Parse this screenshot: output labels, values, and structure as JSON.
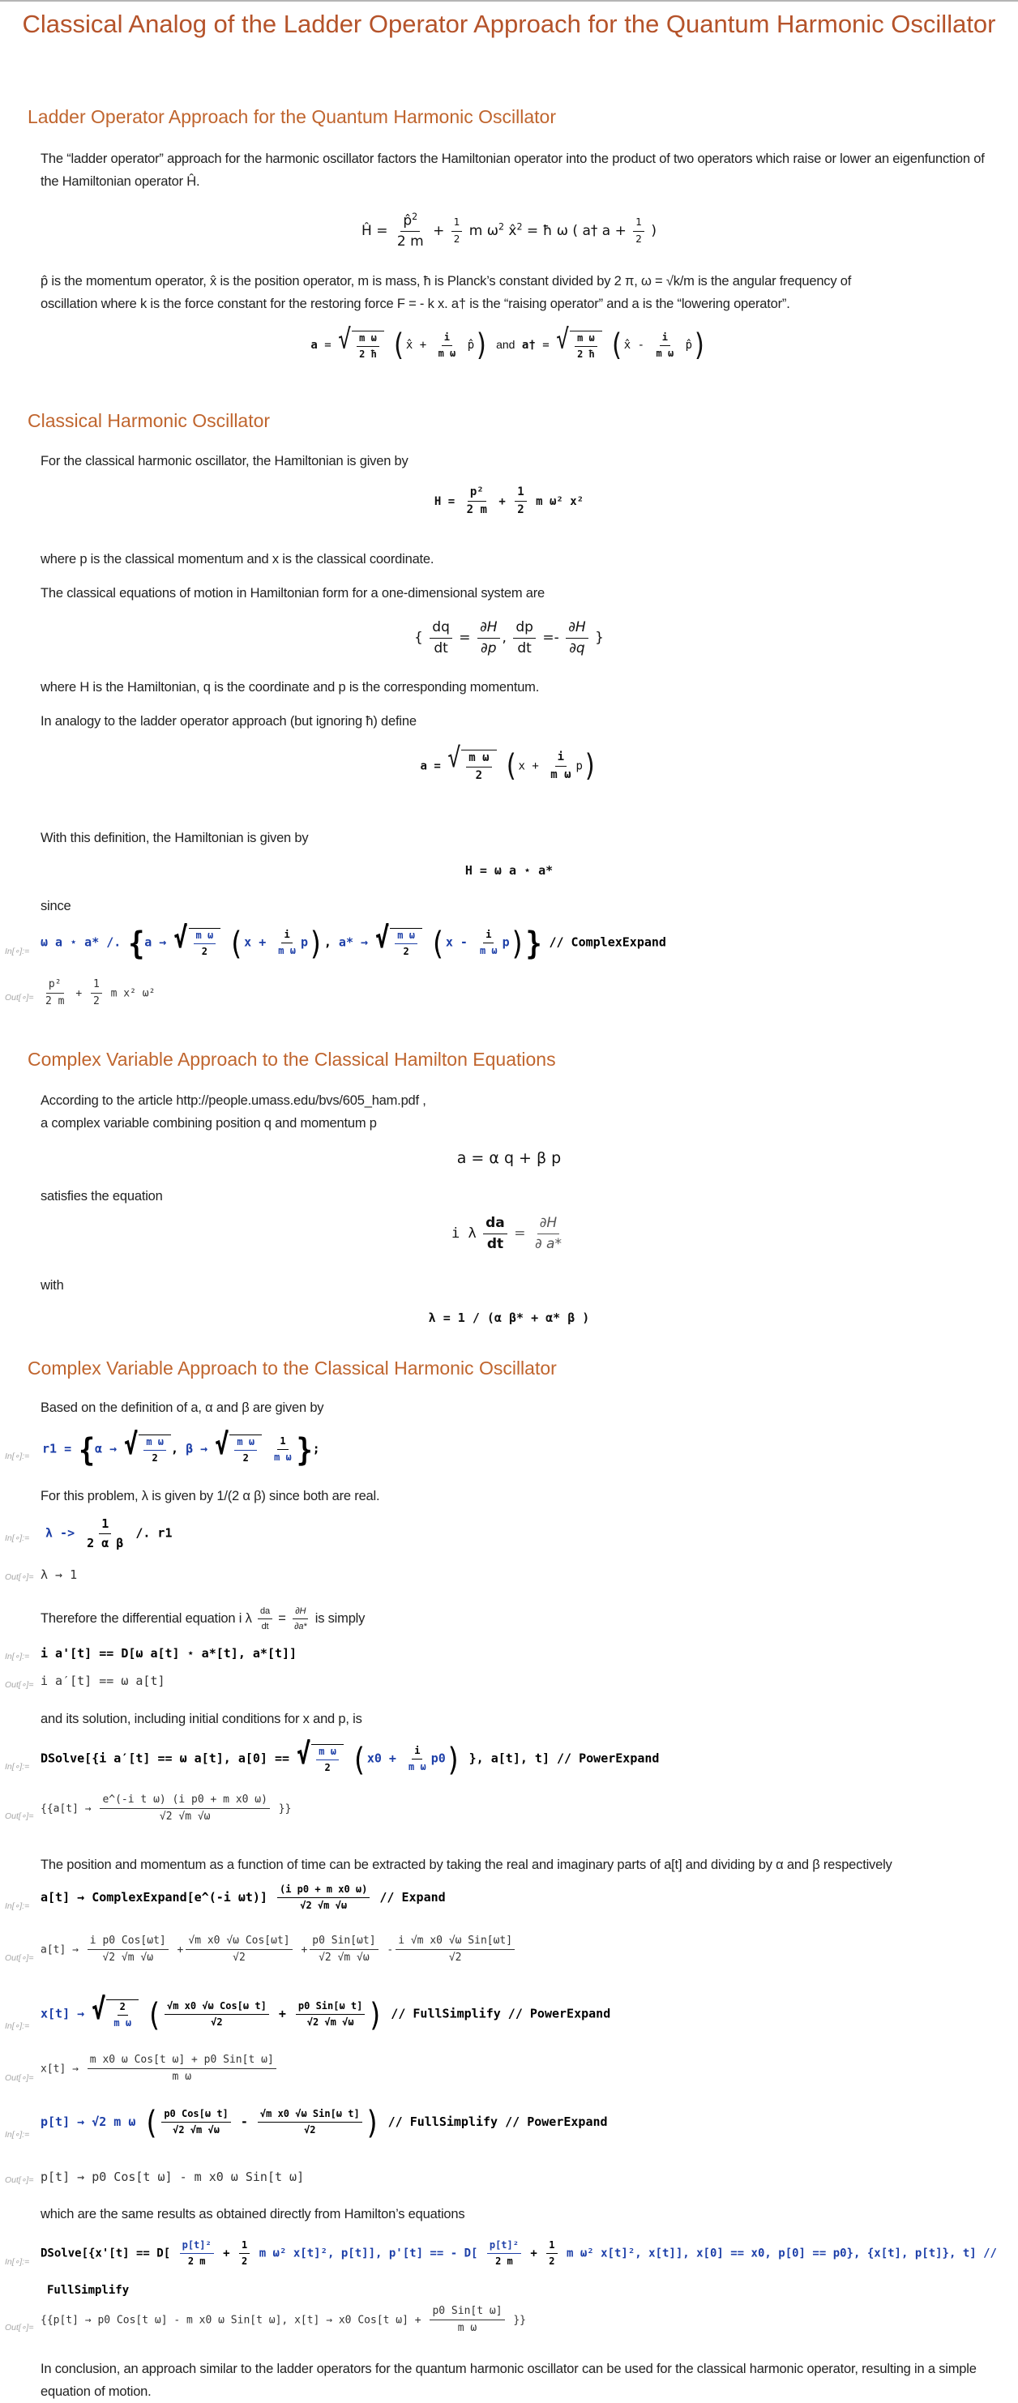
{
  "title": "Classical Analog of the Ladder Operator Approach for the Quantum Harmonic Oscillator",
  "sections": [
    {
      "heading": "Ladder Operator Approach for the Quantum Harmonic Oscillator",
      "p1": "The “ladder operator” approach for the harmonic oscillator factors the Hamiltonian operator into the product of two operators which raise or lower an eigenfunction of the Hamiltonian operator Ĥ.",
      "eq1": {
        "lhs": "Ĥ",
        "p_hat": "p̂",
        "p_exp": "2",
        "den1": "2 m",
        "half_num": "1",
        "half_den": "2",
        "mid": "m ω",
        "w_exp": "2",
        "x_hat": "x̂",
        "x_exp": "2",
        "rhs": "ħ ω ( a† a +",
        "rhs_half_num": "1",
        "rhs_half_den": "2",
        "close": ")"
      },
      "p2_line1": "p̂ is the momentum operator,  x̂ is the position operator, m is mass,  ħ is Planck’s constant divided by 2 π,  ω = √k/m  is the angular frequency of",
      "p2_line2": "oscillation where  k is the force constant for the restoring force F = - k x.    a† is the “raising operator” and a is the “lowering operator”.",
      "eq2": {
        "a": "a",
        "num": "m ω",
        "den": "2 ħ",
        "x": "x̂",
        "plus": "+",
        "i": "i",
        "mw": "m ω",
        "p": "p̂",
        "and": "and",
        "adag": "a†",
        "minus": "-"
      }
    },
    {
      "heading": "Classical Harmonic Oscillator",
      "p1": "For the classical harmonic oscillator,  the Hamiltonian is given by",
      "eq1": {
        "lhs": "H =",
        "num1": "p²",
        "den1": "2 m",
        "plus": "+",
        "num2": "1",
        "den2": "2",
        "tail": "m ω² x²"
      },
      "p2": "where p is the classical momentum and x is the classical coordinate.",
      "p3": "The classical equations of motion in Hamiltonian form for a one-dimensional system are",
      "eq2": {
        "open": "{",
        "dq": "dq",
        "dt": "dt",
        "dH": "∂H",
        "dp_": "∂p",
        "comma": ",",
        "dp": "dp",
        "dq_": "∂q",
        "neg": "-",
        "close": "}"
      },
      "p4": "where H is the Hamiltonian, q is the coordinate and p is the corresponding momentum.",
      "p5": "In analogy to the ladder operator approach (but ignoring ħ) define",
      "eq3": {
        "a": "a =",
        "num": "m ω",
        "den": "2",
        "x": "x +",
        "i": "i",
        "mw": "m ω",
        "p": "p"
      },
      "p6": "With this definition, the Hamiltonian is given by",
      "eq4": "H = ω a ⋆ a*",
      "p7": "since",
      "in_label": "In[∘]:=",
      "out_label": "Out[∘]=",
      "cell1_in": {
        "pre": "ω a ⋆ a* /. ",
        "a": "a →",
        "num": "m ω",
        "den": "2",
        "x": "x +",
        "i": "i",
        "mw": "m ω",
        "p": "p",
        "astar": "a* →",
        "xm": "x -",
        "post": "// ComplexExpand"
      },
      "cell1_out": {
        "num1": "p²",
        "den1": "2 m",
        "plus": "+",
        "num2": "1",
        "den2": "2",
        "tail": "m x² ω²"
      }
    },
    {
      "heading": "Complex Variable Approach to the Classical Hamilton Equations",
      "p1": "According to the article  http://people.umass.edu/bvs/605_ham.pdf ,",
      "p2": "a complex variable combining position q and momentum p",
      "eq1": "a = α q + β p",
      "p3": "satisfies the equation",
      "eq2": {
        "lhs": "i λ",
        "num": "da",
        "den": "dt",
        "eq": "=",
        "rnum": "∂H",
        "rden": "∂ a*"
      },
      "p4": "with",
      "eq3": "λ = 1 / (α β* + α* β )"
    },
    {
      "heading": "Complex Variable Approach to the Classical Harmonic Oscillator",
      "p1": "Based on the definition of a, α and β are given by",
      "cell1_in": {
        "pre": "r1 = ",
        "alpha": "α →",
        "num": "m ω",
        "den": "2",
        "beta": "β →",
        "one": "1",
        "mw": "m ω",
        "end": ";"
      },
      "p2": "For this problem, λ is given by 1/(2 α β) since both are real.",
      "cell2_in": {
        "pre": "λ ->",
        "num": "1",
        "den": "2 α β",
        "post": "/. r1"
      },
      "cell2_out": "λ → 1",
      "p3_pre": "Therefore the differential equation i λ",
      "p3_num": "da",
      "p3_den": "dt",
      "p3_eq": "=",
      "p3_rnum": "∂H",
      "p3_rden": "∂a*",
      "p3_post": "is simply",
      "cell3_in": "i a'[t] == D[ω a[t] ⋆ a*[t], a*[t]]",
      "cell3_out": "i a′[t] == ω a[t]",
      "p4": "and its solution, including initial conditions for x and p,  is",
      "cell4_in": {
        "pre": "DSolve[{i a′[t] == ω a[t], a[0] ==",
        "num": "m ω",
        "den": "2",
        "x0": "x0 +",
        "i": "i",
        "mw": "m ω",
        "p0": "p0",
        "post": "}, a[t], t] // PowerExpand"
      },
      "cell4_out": {
        "pre": "{{a[t] →",
        "num": "e^(-i t ω) (i p0 + m x0 ω)",
        "den": "√2 √m √ω",
        "post": "}}"
      },
      "p5": "The position and momentum as a function of time can be extracted by taking the real and imaginary parts of a[t] and dividing by α and β respectively",
      "cell5_in": {
        "pre": "a[t] → ComplexExpand[e^(-i ωt)]",
        "num": "(i p0 + m x0 ω)",
        "den": "√2 √m √ω",
        "post": "// Expand"
      },
      "cell5_out": {
        "pre": "a[t] →",
        "terms": [
          {
            "sign": "",
            "num": "i p0 Cos[ωt]",
            "den": "√2 √m √ω"
          },
          {
            "sign": "+",
            "num": "√m x0 √ω Cos[ωt]",
            "den": "√2"
          },
          {
            "sign": "+",
            "num": "p0 Sin[ωt]",
            "den": "√2 √m √ω"
          },
          {
            "sign": "-",
            "num": "i √m x0 √ω Sin[ωt]",
            "den": "√2"
          }
        ]
      },
      "cell6_in": {
        "pre": "x[t] →",
        "num": "2",
        "den": "m ω",
        "t1num": "√m x0 √ω Cos[ω t]",
        "t1den": "√2",
        "plus": "+",
        "t2num": "p0 Sin[ω t]",
        "t2den": "√2 √m √ω",
        "post": "// FullSimplify // PowerExpand"
      },
      "cell6_out": {
        "pre": "x[t] →",
        "num": "m x0 ω Cos[t ω] + p0 Sin[t ω]",
        "den": "m ω"
      },
      "cell7_in": {
        "pre": "p[t] → √2 m ω",
        "t1num": "p0 Cos[ω t]",
        "t1den": "√2 √m √ω",
        "minus": "-",
        "t2num": "√m x0 √ω Sin[ω t]",
        "t2den": "√2",
        "post": "// FullSimplify // PowerExpand"
      },
      "cell7_out": "p[t] → p0 Cos[t ω] - m x0 ω Sin[t ω]",
      "p6": "which are the same results as obtained directly from Hamilton’s equations",
      "cell8_in": {
        "pre": "DSolve[{x'[t] == D[",
        "num": "p[t]²",
        "den": "2 m",
        "plus": "+",
        "hnum": "1",
        "hden": "2",
        "mid1": "m ω² x[t]², p[t]], p'[t] == - D[",
        "mid2": "m ω² x[t]², x[t]], x[0] == x0, p[0] == p0}, {x[t], p[t]}, t] //",
        "line2": "FullSimplify"
      },
      "cell8_out": {
        "pre": "{{p[t] → p0 Cos[t ω] - m x0 ω Sin[t ω], x[t] → x0 Cos[t ω] +",
        "num": "p0 Sin[t ω]",
        "den": "m ω",
        "post": "}}"
      },
      "conclusion": "In conclusion, an approach similar to the ladder operators for the quantum harmonic oscillator can be used for the classical harmonic operator, resulting in a simple equation of motion."
    }
  ],
  "colors": {
    "title": "#b5532a",
    "heading": "#c0652e",
    "code_symbol": "#1d3fa8",
    "cell_label": "#a6a6a6"
  }
}
